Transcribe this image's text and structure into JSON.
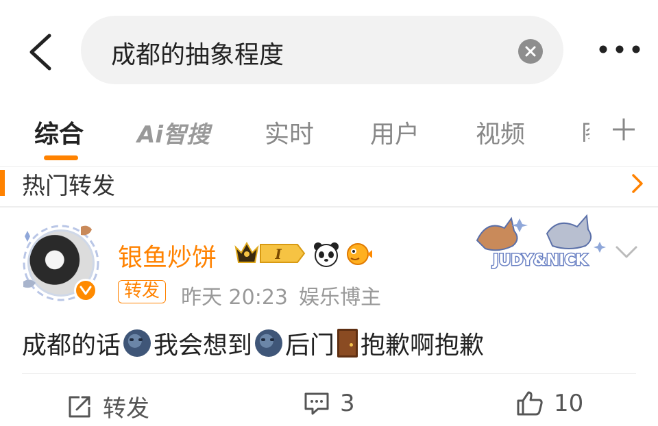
{
  "search": {
    "query": "成都的抽象程度"
  },
  "tabs": {
    "items": [
      "综合",
      "Ai智搜",
      "实时",
      "用户",
      "视频",
      "图"
    ],
    "active": "综合"
  },
  "section": {
    "title": "热门转发"
  },
  "post": {
    "username": "银鱼炒饼",
    "level_badge": "I",
    "repost_tag": "转发",
    "time": "昨天 20:23",
    "source": "娱乐博主",
    "deco_text": "JUDY&NICK",
    "content_parts": [
      "成都的话",
      "我会想到",
      "后门",
      "抱歉啊抱歉"
    ],
    "actions": {
      "repost_label": "转发",
      "comment_count": "3",
      "like_count": "10"
    }
  },
  "colors": {
    "accent": "#ff8200",
    "text": "#222222",
    "muted": "#999999"
  }
}
